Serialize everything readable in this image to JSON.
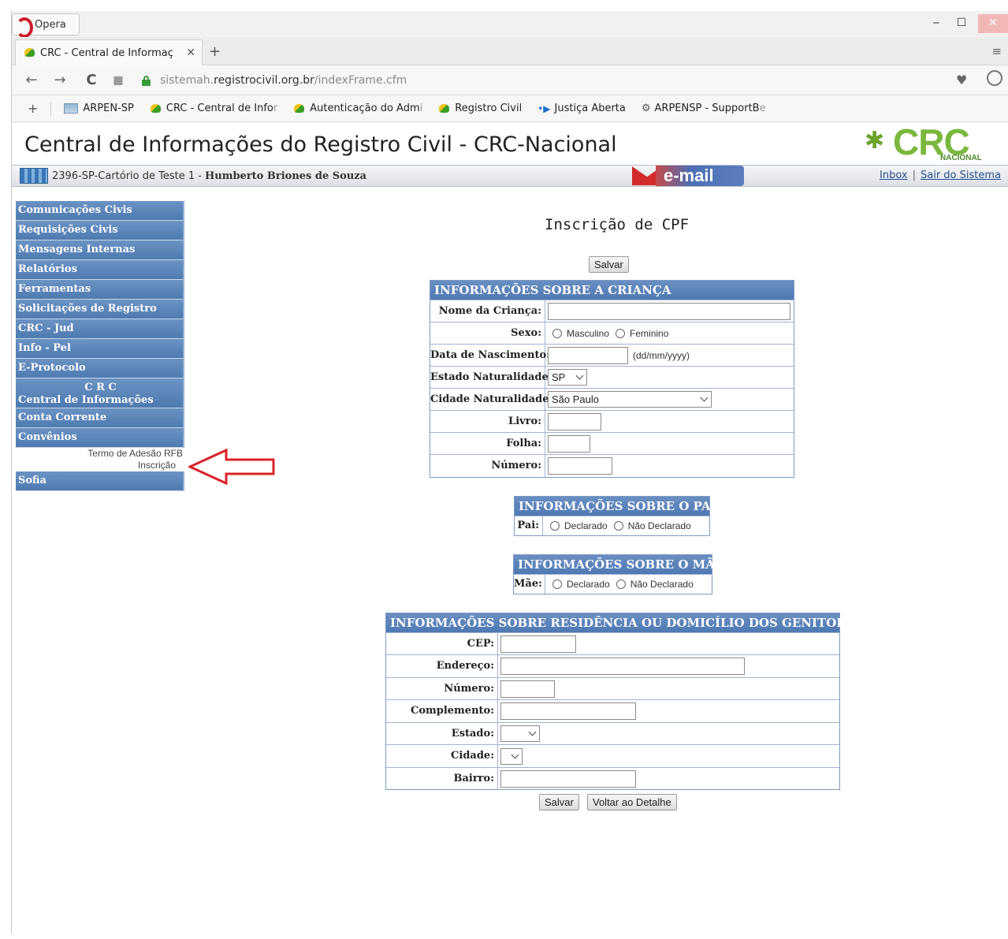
{
  "browser": {
    "menu_label": "Opera",
    "tab_title": "CRC - Central de Informaç",
    "tab_close": "✕",
    "new_tab": "+",
    "url_prefix": "sistemah.",
    "url_host": "registrocivil.org.br",
    "url_path": "/indexFrame.cfm",
    "bookmarks": [
      {
        "label": "ARPEN-SP",
        "fade": "",
        "icon": "image-icon"
      },
      {
        "label": "CRC - Central de Info",
        "fade": "r",
        "icon": "leaf-icon"
      },
      {
        "label": "Autenticação do Adm",
        "fade": "i",
        "icon": "leaf-icon"
      },
      {
        "label": "Registro Civil",
        "fade": "",
        "icon": "leaf-icon"
      },
      {
        "label": "Justiça Aberta",
        "fade": "",
        "icon": "arrow-icon"
      },
      {
        "label": "ARPENSP - SupportB",
        "fade": "e",
        "icon": "gear-icon"
      }
    ]
  },
  "header": {
    "title": "Central de Informações do Registro Civil - CRC-Nacional",
    "logo_main": "CRC",
    "logo_sub": "NACIONAL",
    "office": "2396-SP-Cartório de Teste 1 - ",
    "user": "Humberto Briones de Souza",
    "email_label": "e-mail",
    "inbox_link": "Inbox",
    "logout_link": "Sair do Sistema",
    "link_sep": "|"
  },
  "sidebar": {
    "items": [
      "Comunicações Civis",
      "Requisições Civis",
      "Mensagens Internas",
      "Relatórios",
      "Ferramentas",
      "Solicitações de Registro",
      "CRC - Jud",
      "Info - Pel",
      "E-Protocolo"
    ],
    "central_line1": "C R C",
    "central_line2": "Central de Informações",
    "conta": "Conta Corrente",
    "convenios": "Convênios",
    "sub_termo": "Termo de Adesão RFB",
    "sub_inscricao": "Inscrição",
    "sofia": "Sofia"
  },
  "main": {
    "title": "Inscrição de CPF",
    "save_top": "Salvar",
    "save_bottom": "Salvar",
    "back_button": "Voltar ao Detalhe"
  },
  "crianca": {
    "heading": "INFORMAÇÕES SOBRE A CRIANÇA",
    "nome_label": "Nome da Criança:",
    "nome_value": "",
    "sexo_label": "Sexo:",
    "sexo_opt1": "Masculino",
    "sexo_opt2": "Feminino",
    "data_label": "Data de Nascimento:",
    "data_value": "",
    "data_hint": "(dd/mm/yyyy)",
    "estado_label": "Estado Naturalidade:",
    "estado_value": "SP",
    "cidade_label": "Cidade Naturalidade:",
    "cidade_value": "São Paulo",
    "livro_label": "Livro:",
    "livro_value": "",
    "folha_label": "Folha:",
    "folha_value": "",
    "numero_label": "Número:",
    "numero_value": ""
  },
  "pai": {
    "heading": "INFORMAÇÕES SOBRE O PAI",
    "label": "Pai:",
    "opt1": "Declarado",
    "opt2": "Não Declarado"
  },
  "mae": {
    "heading": "INFORMAÇÕES SOBRE O MÃE",
    "label": "Mãe:",
    "opt1": "Declarado",
    "opt2": "Não Declarado"
  },
  "residencia": {
    "heading": "INFORMAÇÕES SOBRE RESIDÊNCIA OU DOMICÍLIO DOS GENITORES",
    "cep_label": "CEP:",
    "endereco_label": "Endereço:",
    "numero_label": "Número:",
    "complemento_label": "Complemento:",
    "estado_label": "Estado:",
    "estado_value": "",
    "cidade_label": "Cidade:",
    "cidade_value": "",
    "bairro_label": "Bairro:"
  }
}
